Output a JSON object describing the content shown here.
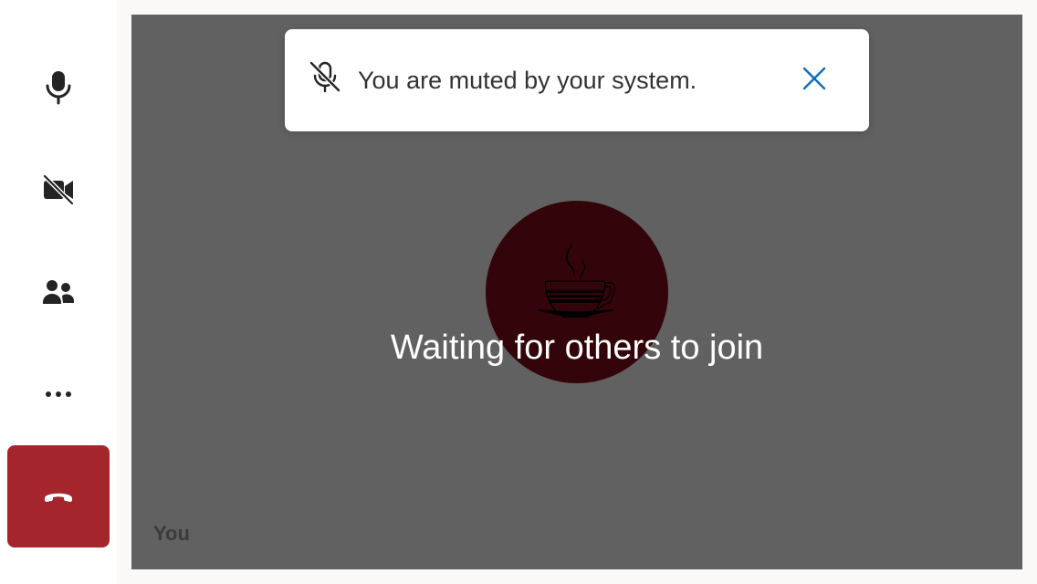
{
  "sidebar": {
    "buttons": [
      {
        "name": "microphone",
        "icon": "microphone-icon"
      },
      {
        "name": "camera",
        "icon": "camera-off-icon"
      },
      {
        "name": "people",
        "icon": "people-icon"
      },
      {
        "name": "more",
        "icon": "more-options-icon"
      },
      {
        "name": "hang-up",
        "icon": "hang-up-icon"
      }
    ],
    "hangup_color": "#a4262c"
  },
  "notification": {
    "icon": "mic-off-icon",
    "message": "You are muted by your system.",
    "close_icon": "close-icon",
    "close_color": "#0f6cbd"
  },
  "stage": {
    "avatar_emoji": "☕",
    "avatar_color": "#33050a",
    "status": "Waiting for others to join",
    "self_label": "You"
  }
}
